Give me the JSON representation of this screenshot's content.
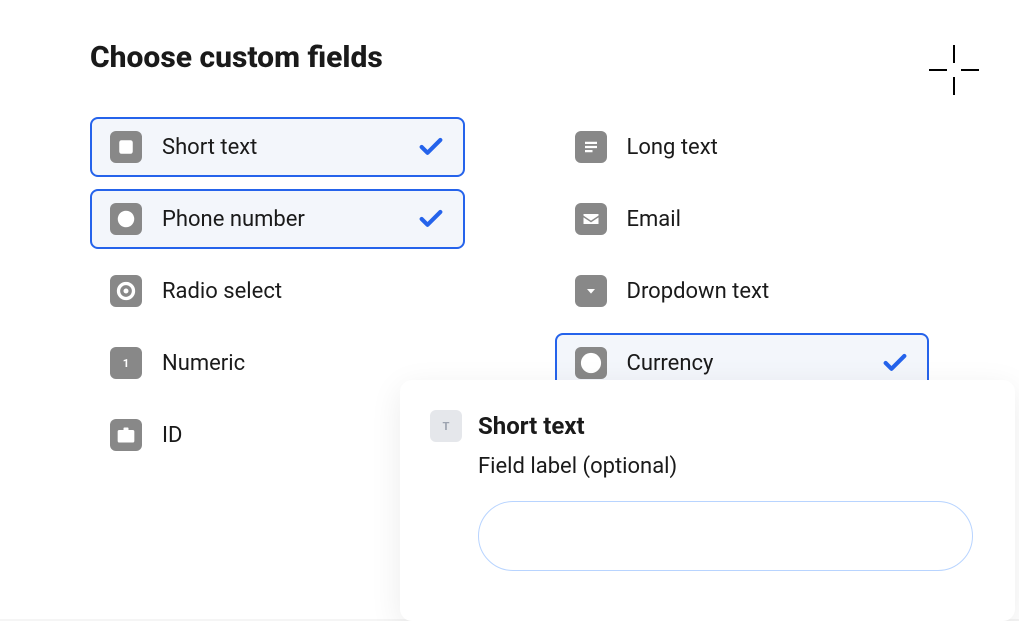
{
  "title": "Choose custom fields",
  "columns": {
    "left": [
      {
        "id": "short-text",
        "label": "Short text",
        "icon": "text",
        "selected": true
      },
      {
        "id": "phone-number",
        "label": "Phone number",
        "icon": "phone",
        "selected": true
      },
      {
        "id": "radio-select",
        "label": "Radio select",
        "icon": "radio",
        "selected": false
      },
      {
        "id": "numeric",
        "label": "Numeric",
        "icon": "numeric",
        "selected": false
      },
      {
        "id": "id",
        "label": "ID",
        "icon": "id",
        "selected": false
      }
    ],
    "right": [
      {
        "id": "long-text",
        "label": "Long text",
        "icon": "longtext",
        "selected": false
      },
      {
        "id": "email",
        "label": "Email",
        "icon": "email",
        "selected": false
      },
      {
        "id": "dropdown-text",
        "label": "Dropdown text",
        "icon": "dropdown",
        "selected": false
      },
      {
        "id": "currency",
        "label": "Currency",
        "icon": "currency",
        "selected": true
      }
    ]
  },
  "popover": {
    "icon": "text",
    "title": "Short text",
    "subtitle": "Field label (optional)",
    "input_value": ""
  }
}
